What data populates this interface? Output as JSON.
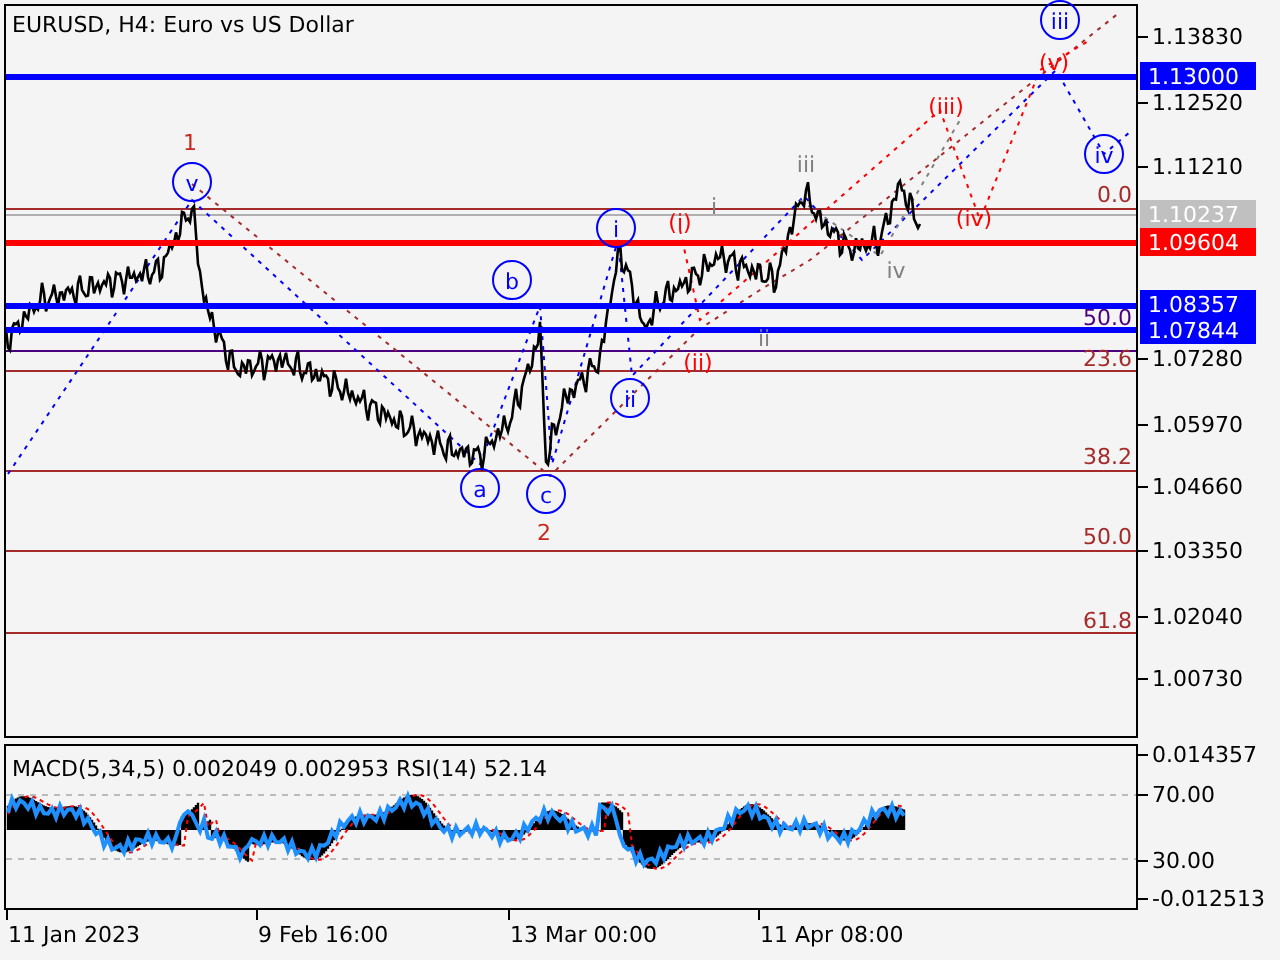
{
  "title": "EURUSD, H4:  Euro vs US Dollar",
  "price_axis": {
    "ticks": [
      "1.13830",
      "1.12520",
      "1.11210",
      "1.07280",
      "1.05970",
      "1.04660",
      "1.03350",
      "1.02040",
      "1.00730"
    ]
  },
  "price_tags": [
    {
      "text": "1.13000",
      "color": "#0000ff"
    },
    {
      "text": "1.10237",
      "color": "#c0c0c0"
    },
    {
      "text": "1.09604",
      "color": "#ff0000"
    },
    {
      "text": "1.08357",
      "color": "#0000ff"
    },
    {
      "text": "1.07844",
      "color": "#0000ff"
    }
  ],
  "fib_labels": [
    {
      "text": "0.0",
      "color": "#a52a2a"
    },
    {
      "text": "50.0",
      "color": "#4b0082"
    },
    {
      "text": "23.6",
      "color": "#a52a2a"
    },
    {
      "text": "38.2",
      "color": "#a52a2a"
    },
    {
      "text": "50.0",
      "color": "#a52a2a"
    },
    {
      "text": "61.8",
      "color": "#a52a2a"
    }
  ],
  "waves": [
    {
      "text": "1",
      "kind": "plain",
      "color": "#c8281e"
    },
    {
      "text": "v",
      "kind": "circled",
      "color": "#0000ff"
    },
    {
      "text": "i",
      "kind": "circled",
      "color": "#0000ff"
    },
    {
      "text": "(i)",
      "kind": "plain",
      "color": "#ff0000"
    },
    {
      "text": "i",
      "kind": "plain",
      "color": "#808080"
    },
    {
      "text": "iii",
      "kind": "plain",
      "color": "#808080"
    },
    {
      "text": "(iii)",
      "kind": "plain",
      "color": "#ff0000"
    },
    {
      "text": "(v)",
      "kind": "plain",
      "color": "#ff0000"
    },
    {
      "text": "iii",
      "kind": "circled",
      "color": "#0000ff"
    },
    {
      "text": "iv",
      "kind": "circled",
      "color": "#0000ff"
    },
    {
      "text": "(iv)",
      "kind": "plain",
      "color": "#ff0000"
    },
    {
      "text": "iv",
      "kind": "plain",
      "color": "#808080"
    },
    {
      "text": "ii",
      "kind": "plain",
      "color": "#808080"
    },
    {
      "text": "(ii)",
      "kind": "plain",
      "color": "#ff0000"
    },
    {
      "text": "ii",
      "kind": "circled",
      "color": "#0000ff"
    },
    {
      "text": "b",
      "kind": "circled",
      "color": "#0000ff"
    },
    {
      "text": "a",
      "kind": "circled",
      "color": "#0000ff"
    },
    {
      "text": "c",
      "kind": "circled",
      "color": "#0000ff"
    },
    {
      "text": "2",
      "kind": "plain",
      "color": "#c8281e"
    }
  ],
  "indicator": {
    "label": "MACD(5,34,5) 0.002049 0.002953 RSI(14) 52.14",
    "ticks": [
      "0.014357",
      "70.00",
      "30.00",
      "-0.012513"
    ]
  },
  "time_axis": {
    "ticks": [
      "11 Jan 2023",
      "9 Feb 16:00",
      "13 Mar 00:00",
      "11 Apr 08:00"
    ]
  }
}
